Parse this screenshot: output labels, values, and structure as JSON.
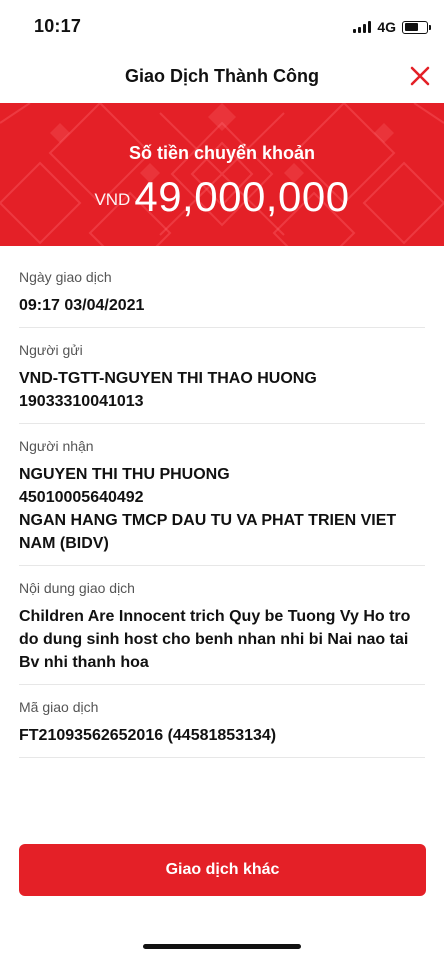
{
  "status_bar": {
    "time": "10:17",
    "network": "4G"
  },
  "header": {
    "title": "Giao Dịch Thành Công",
    "close_icon": "close-icon"
  },
  "banner": {
    "label": "Số tiền chuyển khoản",
    "currency": "VND",
    "amount": "49,000,000"
  },
  "details": [
    {
      "label": "Ngày giao dịch",
      "lines": [
        "09:17 03/04/2021"
      ]
    },
    {
      "label": "Người gửi",
      "lines": [
        "VND-TGTT-NGUYEN THI THAO HUONG",
        "19033310041013"
      ]
    },
    {
      "label": "Người nhận",
      "lines": [
        "NGUYEN THI THU PHUONG",
        "45010005640492",
        "NGAN HANG TMCP DAU TU VA PHAT TRIEN VIET NAM (BIDV)"
      ]
    },
    {
      "label": "Nội dung giao dịch",
      "lines": [
        "Children Are Innocent trich Quy be Tuong Vy Ho tro do dung sinh host cho benh nhan nhi bi Nai nao tai Bv nhi thanh hoa"
      ]
    },
    {
      "label": "Mã giao dịch",
      "lines": [
        "FT21093562652016 (44581853134)"
      ]
    }
  ],
  "actions": {
    "primary_label": "Giao dịch khác"
  },
  "colors": {
    "brand_red": "#e42027",
    "text": "#111111",
    "label": "#555555"
  }
}
